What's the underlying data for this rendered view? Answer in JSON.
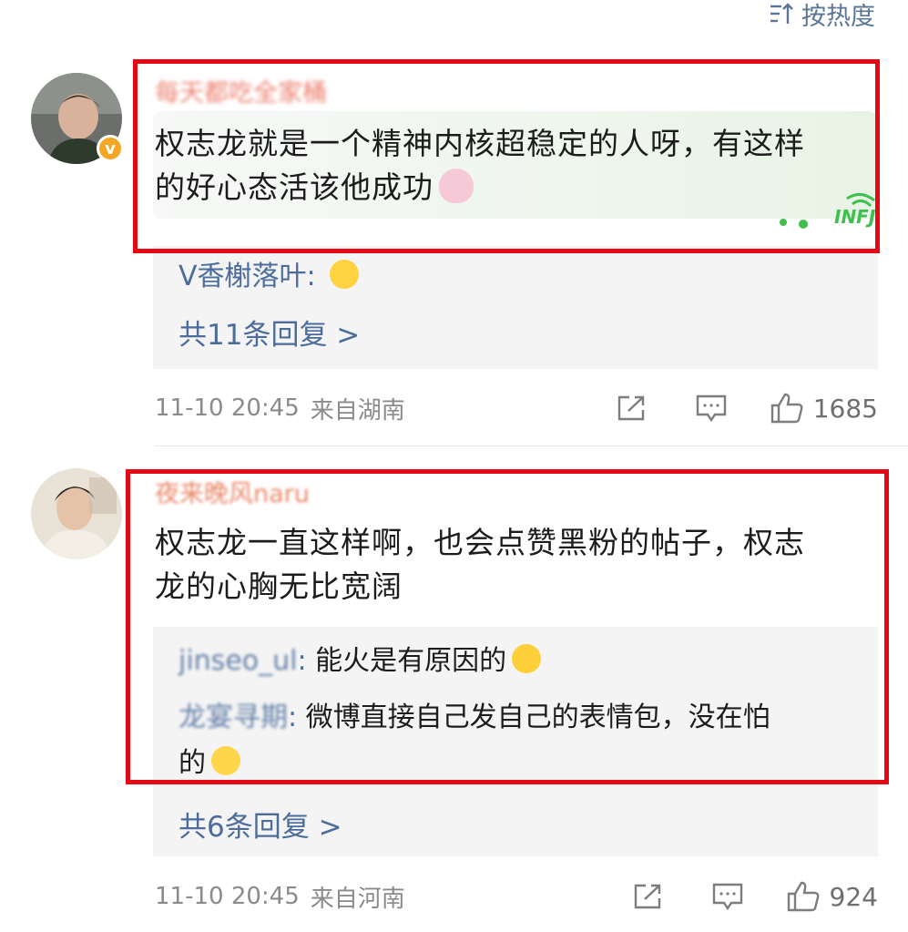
{
  "sort": {
    "label": "按热度",
    "icon": "sort-icon"
  },
  "comments": [
    {
      "username": "每天都吃全家桶",
      "text_line1": "权志龙就是一个精神内核超稳定的人呀，有这样",
      "text_line2": "的好心态活该他成功",
      "verified_badge": "v",
      "card_badge": "INFJ",
      "replies": [
        {
          "user": "V香榭落叶",
          "text": ""
        }
      ],
      "more_replies": "共11条回复 >",
      "time": "11-10 20:45",
      "source": "来自湖南",
      "likes": "1685"
    },
    {
      "username": "夜来晚风naru",
      "text_line1": "权志龙一直这样啊，也会点赞黑粉的帖子，权志",
      "text_line2": "龙的心胸无比宽阔",
      "replies": [
        {
          "user": "jinseo_ul",
          "text": "能火是有原因的"
        },
        {
          "user": "龙宴寻期",
          "text": "微博直接自己发自己的表情包，没在怕",
          "text2": "的"
        }
      ],
      "more_replies": "共6条回复 >",
      "time": "11-10 20:45",
      "source": "来自河南",
      "likes": "924"
    }
  ],
  "colors": {
    "highlight_box": "#e50914",
    "link_blue": "#4c6d9c",
    "meta_gray": "#8b8b8b"
  }
}
